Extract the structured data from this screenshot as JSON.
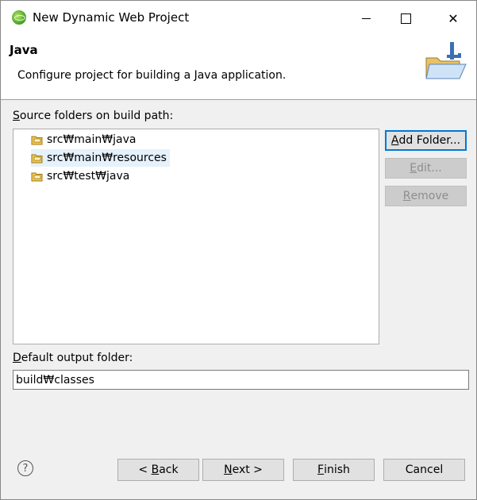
{
  "window": {
    "title": "New Dynamic Web Project",
    "controls": {
      "minimize": "minimize",
      "maximize": "maximize",
      "close": "✕"
    }
  },
  "banner": {
    "title": "Java",
    "description": "Configure project for building a Java application."
  },
  "source_folders": {
    "label_prefix": "S",
    "label_rest": "ource folders on build path:",
    "items": [
      {
        "label": "src₩main₩java",
        "icon": "source-folder-icon"
      },
      {
        "label": "src₩main₩resources",
        "icon": "source-folder-icon",
        "selected": true
      },
      {
        "label": "src₩test₩java",
        "icon": "source-folder-icon"
      }
    ]
  },
  "side_buttons": {
    "add_folder": {
      "prefix": "A",
      "rest": "dd Folder..."
    },
    "edit": {
      "prefix": "E",
      "rest": "dit..."
    },
    "remove": {
      "prefix": "R",
      "rest": "emove"
    }
  },
  "output": {
    "label_prefix": "D",
    "label_rest": "efault output folder:",
    "value": "build₩classes"
  },
  "footer": {
    "help_icon": "?",
    "back": {
      "pre": "< ",
      "accel": "B",
      "rest": "ack"
    },
    "next": {
      "accel": "N",
      "rest": "ext >"
    },
    "finish": {
      "accel": "F",
      "rest": "inish"
    },
    "cancel": "Cancel"
  },
  "colors": {
    "selection": "#e5f1fb",
    "default_button_border": "#0078d7",
    "dialog_bg": "#f0f0f0"
  }
}
